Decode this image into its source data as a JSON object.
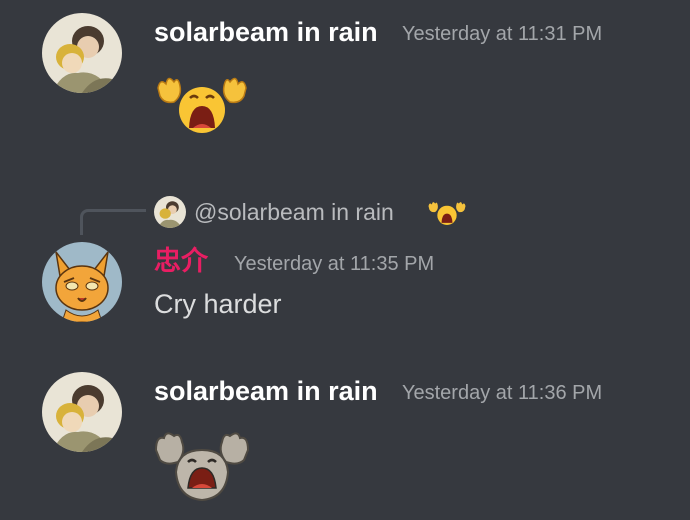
{
  "messages": [
    {
      "author": "solarbeam in rain",
      "timestamp": "Yesterday at 11:31 PM",
      "emoji_name": "crying-emoji-icon",
      "avatar_icon": "anime-avatar-icon"
    },
    {
      "reply_to": "@solarbeam in rain",
      "reply_emoji": "crying-emoji-icon",
      "author": "忠介",
      "author_color": "#e91e63",
      "timestamp": "Yesterday at 11:35 PM",
      "text": "Cry harder",
      "avatar_icon": "orange-cat-avatar-icon"
    },
    {
      "author": "solarbeam in rain",
      "timestamp": "Yesterday at 11:36 PM",
      "emoji_name": "crying-geodude-emoji-icon",
      "avatar_icon": "anime-avatar-icon"
    }
  ],
  "colors": {
    "background": "#36393f",
    "username": "#ffffff",
    "timestamp": "#a3a6aa",
    "text": "#dcddde",
    "role_pink": "#e91e63"
  }
}
